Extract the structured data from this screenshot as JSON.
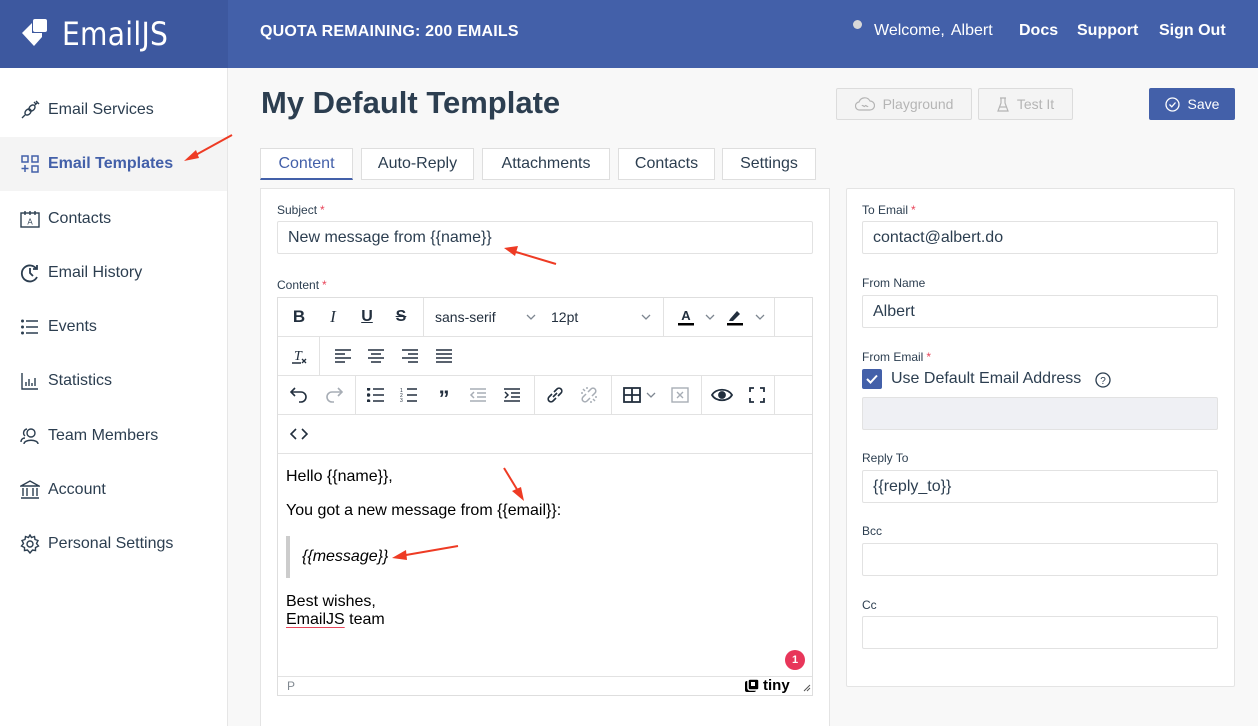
{
  "header": {
    "brand": "EmailJS",
    "quota": "QUOTA REMAINING: 200 EMAILS",
    "welcome": "Welcome,",
    "user": "Albert",
    "links": [
      "Docs",
      "Support",
      "Sign Out"
    ]
  },
  "sidebar": {
    "items": [
      {
        "label": "Email Services",
        "icon": "plug-icon",
        "active": false
      },
      {
        "label": "Email Templates",
        "icon": "templates-icon",
        "active": true
      },
      {
        "label": "Contacts",
        "icon": "contacts-icon",
        "active": false
      },
      {
        "label": "Email History",
        "icon": "history-icon",
        "active": false
      },
      {
        "label": "Events",
        "icon": "list-icon",
        "active": false
      },
      {
        "label": "Statistics",
        "icon": "chart-icon",
        "active": false
      },
      {
        "label": "Team Members",
        "icon": "team-icon",
        "active": false
      },
      {
        "label": "Account",
        "icon": "bank-icon",
        "active": false
      },
      {
        "label": "Personal Settings",
        "icon": "gear-icon",
        "active": false
      }
    ]
  },
  "page": {
    "title": "My Default Template",
    "buttons": {
      "playground": "Playground",
      "test": "Test It",
      "save": "Save"
    },
    "tabs": [
      "Content",
      "Auto-Reply",
      "Attachments",
      "Contacts",
      "Settings"
    ],
    "active_tab": "Content"
  },
  "content": {
    "subject_label": "Subject",
    "subject_value": "New message from {{name}}",
    "content_label": "Content",
    "toolbar": {
      "font_family": "sans-serif",
      "font_size": "12pt"
    },
    "body": {
      "line1": "Hello {{name}},",
      "line2": "You got a new message from {{email}}:",
      "quote": "{{message}}",
      "sign1": "Best wishes,",
      "sign2_brand": "EmailJS",
      "sign2_rest": " team"
    },
    "status_path": "P",
    "notification_count": "1",
    "powered_by": "tiny"
  },
  "settings": {
    "to_email_label": "To Email",
    "to_email_value": "contact@albert.do",
    "from_name_label": "From Name",
    "from_name_value": "Albert",
    "from_email_label": "From Email",
    "use_default_label": "Use Default Email Address",
    "use_default_checked": true,
    "from_email_value": "",
    "reply_to_label": "Reply To",
    "reply_to_value": "{{reply_to}}",
    "bcc_label": "Bcc",
    "bcc_value": "",
    "cc_label": "Cc",
    "cc_value": ""
  },
  "colors": {
    "brand": "#4360a9",
    "required": "#e8455a",
    "text": "#2c3e50"
  }
}
